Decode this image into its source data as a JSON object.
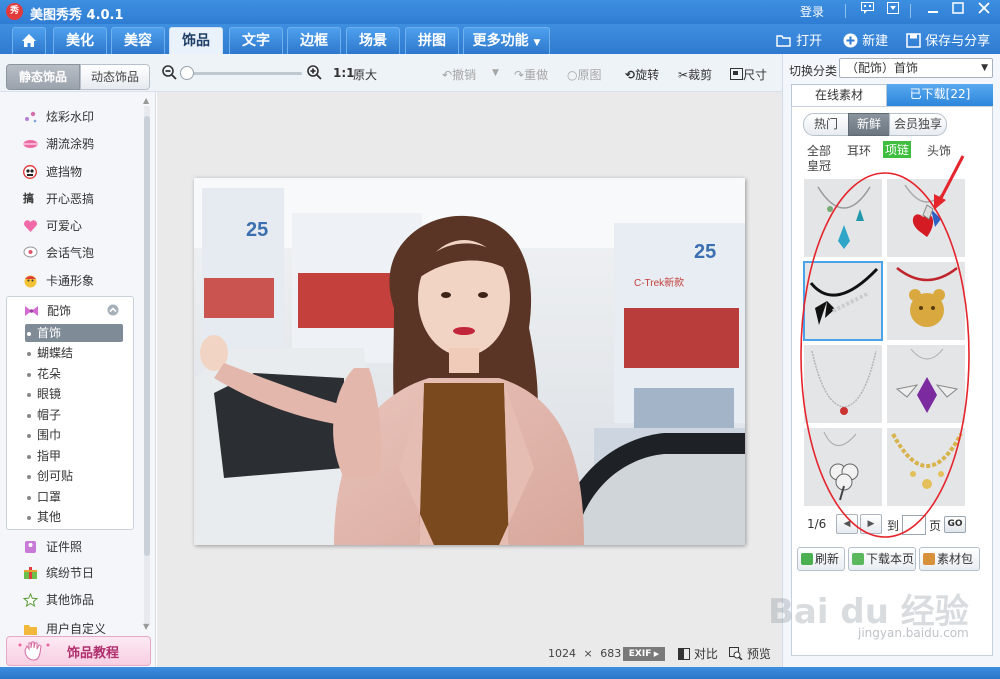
{
  "app": {
    "logo_char": "秀",
    "title": "美图秀秀 4.0.1",
    "login": "登录"
  },
  "tabs": [
    {
      "label": "美化"
    },
    {
      "label": "美容"
    },
    {
      "label": "饰品",
      "active": true
    },
    {
      "label": "文字"
    },
    {
      "label": "边框"
    },
    {
      "label": "场景"
    },
    {
      "label": "拼图"
    }
  ],
  "more_tab": "更多功能",
  "header_actions": {
    "open": "打开",
    "new": "新建",
    "save_share": "保存与分享"
  },
  "mode_toggle": {
    "static": "静态饰品",
    "dynamic": "动态饰品"
  },
  "toolbar": {
    "zoom_1to1": "1:1",
    "original_size": "原大",
    "undo": "撤销",
    "redo": "重做",
    "original_image": "原图",
    "rotate": "旋转",
    "crop": "裁剪",
    "resize": "尺寸"
  },
  "left_panel": {
    "categories_top": [
      {
        "label": "炫彩水印",
        "icon": "sparkle-icon"
      },
      {
        "label": "潮流涂鸦",
        "icon": "lips-icon"
      },
      {
        "label": "遮挡物",
        "icon": "mask-icon"
      },
      {
        "label": "开心恶搞",
        "icon": "funny-icon"
      },
      {
        "label": "可爱心",
        "icon": "heart-icon"
      },
      {
        "label": "会话气泡",
        "icon": "speech-bubble-icon"
      },
      {
        "label": "卡通形象",
        "icon": "cartoon-icon"
      }
    ],
    "accessories_group": {
      "label": "配饰",
      "items": [
        "首饰",
        "蝴蝶结",
        "花朵",
        "眼镜",
        "帽子",
        "围巾",
        "指甲",
        "创可贴",
        "口罩",
        "其他"
      ],
      "selected": "首饰"
    },
    "categories_bottom": [
      {
        "label": "证件照",
        "icon": "id-photo-icon"
      },
      {
        "label": "缤纷节日",
        "icon": "gift-icon"
      },
      {
        "label": "其他饰品",
        "icon": "star-icon"
      },
      {
        "label": "用户自定义",
        "icon": "folder-icon"
      }
    ],
    "tutorial_button": "饰品教程"
  },
  "canvas": {
    "image_width": "1024",
    "times": "×",
    "image_height": "683",
    "exif": "EXIF",
    "compare": "对比",
    "preview": "预览",
    "photo_banner_number": "25",
    "photo_banner_text": "C-Trek新款"
  },
  "right_panel": {
    "switch_label": "切换分类",
    "switch_value": "（配饰）首饰",
    "tab_online": "在线素材",
    "tab_downloaded": "已下载[22]",
    "chips": [
      "热门",
      "新鲜",
      "会员独享"
    ],
    "active_chip": "新鲜",
    "filters": [
      "全部",
      "耳环",
      "项链",
      "头饰",
      "皇冠"
    ],
    "active_filter": "项链",
    "grid_items": [
      {
        "name": "necklace-blue-gems"
      },
      {
        "name": "necklace-red-heart-pendant"
      },
      {
        "name": "necklace-black-bow"
      },
      {
        "name": "pendant-gold-bear"
      },
      {
        "name": "necklace-silver-chain"
      },
      {
        "name": "pendant-purple-gem"
      },
      {
        "name": "pendant-silver-clover"
      },
      {
        "name": "necklace-gold-ornate"
      }
    ],
    "pager": {
      "page": "1/6",
      "to": "到",
      "page_unit": "页",
      "go": "GO"
    },
    "buttons": {
      "refresh": "刷新",
      "download_page": "下载本页",
      "material_pack": "素材包"
    }
  },
  "watermark": {
    "text": "Bai du 经验",
    "url": "jingyan.baidu.com"
  },
  "colors": {
    "title_blue": "#2f7dd3",
    "active_filter_green": "#3ebd3e",
    "annotation_red": "#e5242b"
  }
}
